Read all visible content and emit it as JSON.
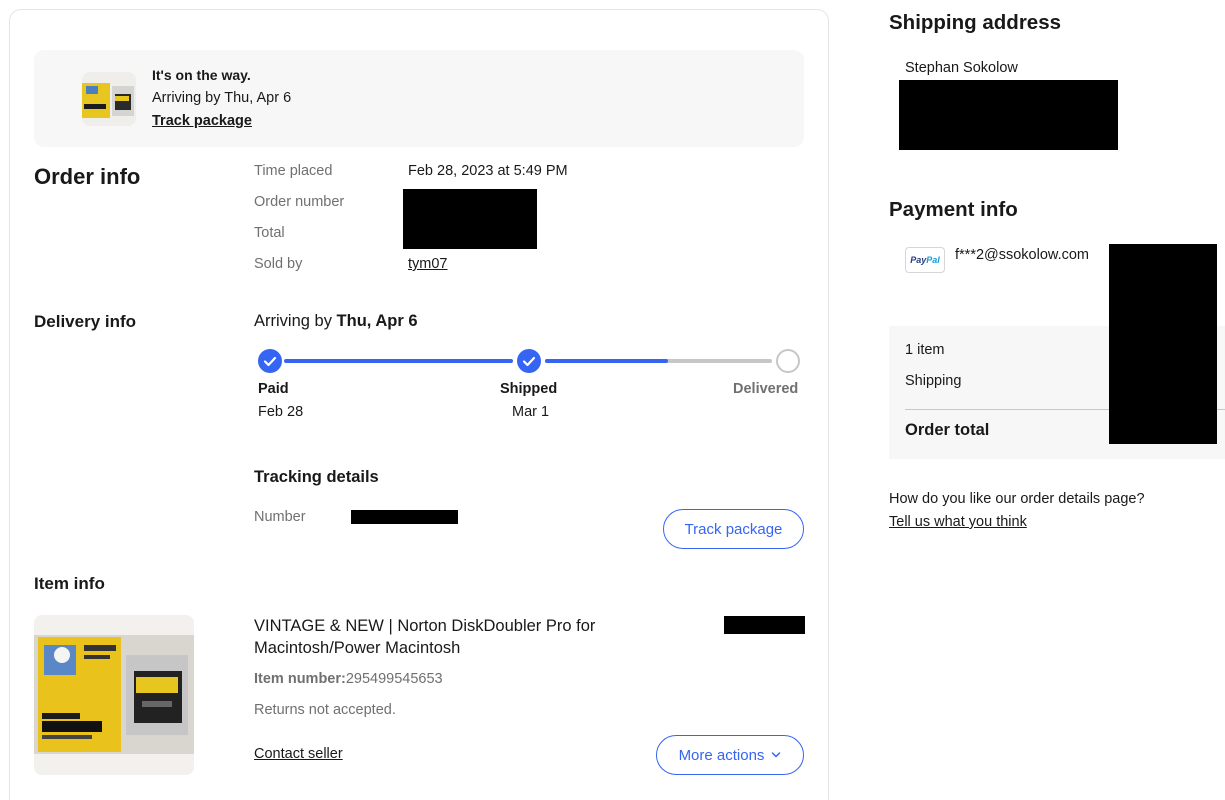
{
  "banner": {
    "status": "It's on the way.",
    "arriving": "Arriving by Thu, Apr 6",
    "track_link": "Track package"
  },
  "order_info": {
    "title": "Order info",
    "time_placed_label": "Time placed",
    "time_placed_value": "Feb 28, 2023 at 5:49 PM",
    "order_number_label": "Order number",
    "total_label": "Total",
    "sold_by_label": "Sold by",
    "sold_by_value": "tym07"
  },
  "delivery_info": {
    "title": "Delivery info",
    "arriving_prefix": "Arriving by ",
    "arriving_date": "Thu, Apr 6",
    "progress_fraction": 0.77,
    "steps": [
      {
        "label": "Paid",
        "date": "Feb 28",
        "status": "complete"
      },
      {
        "label": "Shipped",
        "date": "Mar 1",
        "status": "complete"
      },
      {
        "label": "Delivered",
        "date": "",
        "status": "pending"
      }
    ],
    "tracking_title": "Tracking details",
    "number_label": "Number",
    "track_button": "Track package"
  },
  "item_info": {
    "title": "Item info",
    "item_title": "VINTAGE & NEW | Norton DiskDoubler Pro for Macintosh/Power Macintosh",
    "item_number_label": "Item number:",
    "item_number": "295499545653",
    "returns": "Returns not accepted.",
    "contact_seller": "Contact seller",
    "more_actions": "More actions"
  },
  "shipping_address": {
    "title": "Shipping address",
    "name": "Stephan Sokolow"
  },
  "payment_info": {
    "title": "Payment info",
    "method_icon": "PayPal",
    "email": "f***2@ssokolow.com",
    "summary_items": "1 item",
    "summary_shipping": "Shipping",
    "summary_total": "Order total"
  },
  "feedback": {
    "question": "How do you like our order details page?",
    "link": "Tell us what you think"
  },
  "colors": {
    "accent": "#3665f3",
    "progress_track": "#c7c7c7",
    "panel_bg": "#f7f7f7",
    "muted_text": "#707070"
  }
}
